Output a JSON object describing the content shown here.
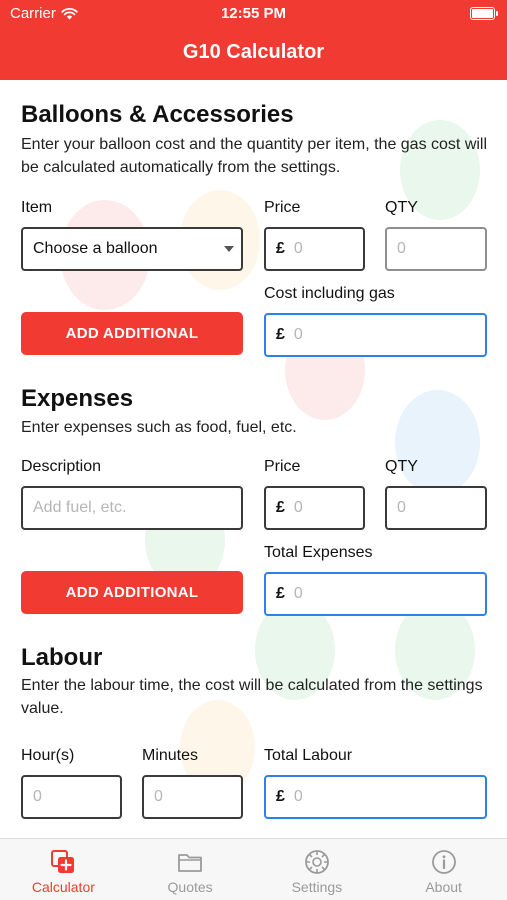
{
  "status_bar": {
    "carrier": "Carrier",
    "time": "12:55 PM"
  },
  "nav": {
    "title": "G10 Calculator"
  },
  "balloons": {
    "title": "Balloons & Accessories",
    "description": "Enter your balloon cost and the quantity per item, the gas cost will be calculated automatically from the settings.",
    "item_label": "Item",
    "price_label": "Price",
    "qty_label": "QTY",
    "item_select": "Choose a balloon",
    "price_currency": "£",
    "price_placeholder": "0",
    "qty_placeholder": "0",
    "cost_label": "Cost including gas",
    "cost_currency": "£",
    "cost_placeholder": "0",
    "add_button": "ADD ADDITIONAL"
  },
  "expenses": {
    "title": "Expenses",
    "description": "Enter expenses such as food, fuel, etc.",
    "description_label": "Description",
    "price_label": "Price",
    "qty_label": "QTY",
    "description_placeholder": "Add fuel, etc.",
    "price_currency": "£",
    "price_placeholder": "0",
    "qty_placeholder": "0",
    "total_label": "Total Expenses",
    "total_currency": "£",
    "total_placeholder": "0",
    "add_button": "ADD ADDITIONAL"
  },
  "labour": {
    "title": "Labour",
    "description": "Enter the labour time, the cost will be calculated from the settings value.",
    "hours_label": "Hour(s)",
    "minutes_label": "Minutes",
    "total_label": "Total Labour",
    "hours_placeholder": "0",
    "minutes_placeholder": "0",
    "total_currency": "£",
    "total_placeholder": "0"
  },
  "tabs": [
    {
      "label": "Calculator",
      "icon": "calculator-icon",
      "active": true
    },
    {
      "label": "Quotes",
      "icon": "folder-icon",
      "active": false
    },
    {
      "label": "Settings",
      "icon": "settings-icon",
      "active": false
    },
    {
      "label": "About",
      "icon": "info-icon",
      "active": false
    }
  ],
  "colors": {
    "accent": "#f03a32",
    "focus_border": "#2f80ed",
    "inactive_tab": "#9a9a9a"
  }
}
